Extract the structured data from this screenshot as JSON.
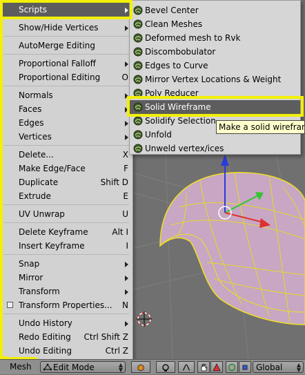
{
  "mesh_menu": {
    "items": [
      {
        "label": "Scripts",
        "shortcut": "",
        "submenu": true,
        "highlighted": true
      },
      {
        "label": "Show/Hide Vertices",
        "shortcut": "",
        "submenu": true
      },
      {
        "label": "AutoMerge Editing",
        "shortcut": "",
        "submenu": false
      },
      {
        "label": "Proportional Falloff",
        "shortcut": "",
        "submenu": true
      },
      {
        "label": "Proportional Editing",
        "shortcut": "O",
        "submenu": false
      },
      {
        "label": "Normals",
        "shortcut": "",
        "submenu": true
      },
      {
        "label": "Faces",
        "shortcut": "",
        "submenu": true
      },
      {
        "label": "Edges",
        "shortcut": "",
        "submenu": true
      },
      {
        "label": "Vertices",
        "shortcut": "",
        "submenu": true
      },
      {
        "label": "Delete...",
        "shortcut": "X",
        "submenu": false
      },
      {
        "label": "Make Edge/Face",
        "shortcut": "F",
        "submenu": false
      },
      {
        "label": "Duplicate",
        "shortcut": "Shift D",
        "submenu": false
      },
      {
        "label": "Extrude",
        "shortcut": "E",
        "submenu": false
      },
      {
        "label": "UV Unwrap",
        "shortcut": "U",
        "submenu": false
      },
      {
        "label": "Delete Keyframe",
        "shortcut": "Alt I",
        "submenu": false
      },
      {
        "label": "Insert Keyframe",
        "shortcut": "I",
        "submenu": false
      },
      {
        "label": "Snap",
        "shortcut": "",
        "submenu": true
      },
      {
        "label": "Mirror",
        "shortcut": "",
        "submenu": true
      },
      {
        "label": "Transform",
        "shortcut": "",
        "submenu": true
      },
      {
        "label": "Transform Properties...",
        "shortcut": "N",
        "submenu": false,
        "checkbox": true
      },
      {
        "label": "Undo History",
        "shortcut": "",
        "submenu": true
      },
      {
        "label": "Redo Editing",
        "shortcut": "Ctrl Shift Z",
        "submenu": false
      },
      {
        "label": "Undo Editing",
        "shortcut": "Ctrl Z",
        "submenu": false
      }
    ]
  },
  "scripts_menu": {
    "items": [
      {
        "label": "Bevel Center"
      },
      {
        "label": "Clean Meshes"
      },
      {
        "label": "Deformed mesh to Rvk"
      },
      {
        "label": "Discombobulator"
      },
      {
        "label": "Edges to Curve"
      },
      {
        "label": "Mirror Vertex Locations & Weight"
      },
      {
        "label": "Poly Reducer"
      },
      {
        "label": "Solid Wireframe",
        "highlighted": true
      },
      {
        "label": "Solidify Selection"
      },
      {
        "label": "Unfold"
      },
      {
        "label": "Unweld vertex/ices"
      }
    ]
  },
  "tooltip": {
    "text": "Make a solid wireframe copy of this mesh"
  },
  "header": {
    "menu_label": "Mesh",
    "mode": "Edit Mode",
    "orientation": "Global"
  },
  "colors": {
    "menu_bg": "#d2d2d2",
    "highlight": "#5d5d5d",
    "annotation": "#f2ef08",
    "mesh_wire": "#f0e020",
    "mesh_fill": "#c7a7c3"
  }
}
